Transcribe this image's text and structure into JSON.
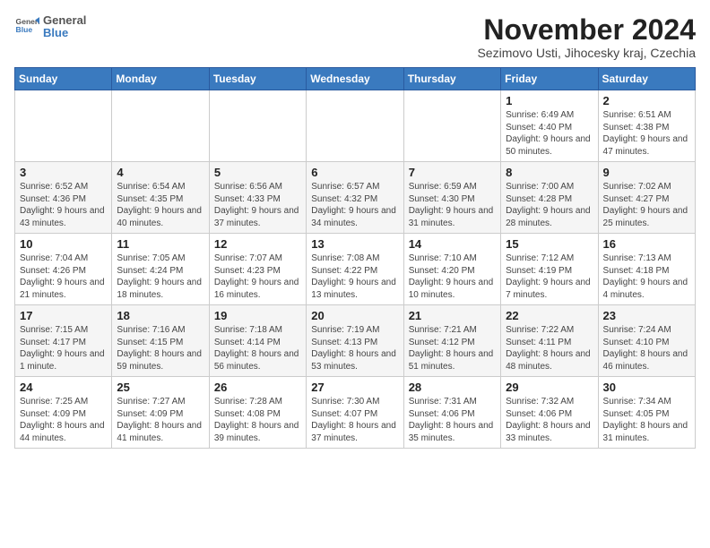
{
  "app": {
    "logo_line1": "General",
    "logo_line2": "Blue"
  },
  "header": {
    "month_title": "November 2024",
    "location": "Sezimovo Usti, Jihocesky kraj, Czechia"
  },
  "weekdays": [
    "Sunday",
    "Monday",
    "Tuesday",
    "Wednesday",
    "Thursday",
    "Friday",
    "Saturday"
  ],
  "weeks": [
    [
      {
        "day": "",
        "info": ""
      },
      {
        "day": "",
        "info": ""
      },
      {
        "day": "",
        "info": ""
      },
      {
        "day": "",
        "info": ""
      },
      {
        "day": "",
        "info": ""
      },
      {
        "day": "1",
        "info": "Sunrise: 6:49 AM\nSunset: 4:40 PM\nDaylight: 9 hours and 50 minutes."
      },
      {
        "day": "2",
        "info": "Sunrise: 6:51 AM\nSunset: 4:38 PM\nDaylight: 9 hours and 47 minutes."
      }
    ],
    [
      {
        "day": "3",
        "info": "Sunrise: 6:52 AM\nSunset: 4:36 PM\nDaylight: 9 hours and 43 minutes."
      },
      {
        "day": "4",
        "info": "Sunrise: 6:54 AM\nSunset: 4:35 PM\nDaylight: 9 hours and 40 minutes."
      },
      {
        "day": "5",
        "info": "Sunrise: 6:56 AM\nSunset: 4:33 PM\nDaylight: 9 hours and 37 minutes."
      },
      {
        "day": "6",
        "info": "Sunrise: 6:57 AM\nSunset: 4:32 PM\nDaylight: 9 hours and 34 minutes."
      },
      {
        "day": "7",
        "info": "Sunrise: 6:59 AM\nSunset: 4:30 PM\nDaylight: 9 hours and 31 minutes."
      },
      {
        "day": "8",
        "info": "Sunrise: 7:00 AM\nSunset: 4:28 PM\nDaylight: 9 hours and 28 minutes."
      },
      {
        "day": "9",
        "info": "Sunrise: 7:02 AM\nSunset: 4:27 PM\nDaylight: 9 hours and 25 minutes."
      }
    ],
    [
      {
        "day": "10",
        "info": "Sunrise: 7:04 AM\nSunset: 4:26 PM\nDaylight: 9 hours and 21 minutes."
      },
      {
        "day": "11",
        "info": "Sunrise: 7:05 AM\nSunset: 4:24 PM\nDaylight: 9 hours and 18 minutes."
      },
      {
        "day": "12",
        "info": "Sunrise: 7:07 AM\nSunset: 4:23 PM\nDaylight: 9 hours and 16 minutes."
      },
      {
        "day": "13",
        "info": "Sunrise: 7:08 AM\nSunset: 4:22 PM\nDaylight: 9 hours and 13 minutes."
      },
      {
        "day": "14",
        "info": "Sunrise: 7:10 AM\nSunset: 4:20 PM\nDaylight: 9 hours and 10 minutes."
      },
      {
        "day": "15",
        "info": "Sunrise: 7:12 AM\nSunset: 4:19 PM\nDaylight: 9 hours and 7 minutes."
      },
      {
        "day": "16",
        "info": "Sunrise: 7:13 AM\nSunset: 4:18 PM\nDaylight: 9 hours and 4 minutes."
      }
    ],
    [
      {
        "day": "17",
        "info": "Sunrise: 7:15 AM\nSunset: 4:17 PM\nDaylight: 9 hours and 1 minute."
      },
      {
        "day": "18",
        "info": "Sunrise: 7:16 AM\nSunset: 4:15 PM\nDaylight: 8 hours and 59 minutes."
      },
      {
        "day": "19",
        "info": "Sunrise: 7:18 AM\nSunset: 4:14 PM\nDaylight: 8 hours and 56 minutes."
      },
      {
        "day": "20",
        "info": "Sunrise: 7:19 AM\nSunset: 4:13 PM\nDaylight: 8 hours and 53 minutes."
      },
      {
        "day": "21",
        "info": "Sunrise: 7:21 AM\nSunset: 4:12 PM\nDaylight: 8 hours and 51 minutes."
      },
      {
        "day": "22",
        "info": "Sunrise: 7:22 AM\nSunset: 4:11 PM\nDaylight: 8 hours and 48 minutes."
      },
      {
        "day": "23",
        "info": "Sunrise: 7:24 AM\nSunset: 4:10 PM\nDaylight: 8 hours and 46 minutes."
      }
    ],
    [
      {
        "day": "24",
        "info": "Sunrise: 7:25 AM\nSunset: 4:09 PM\nDaylight: 8 hours and 44 minutes."
      },
      {
        "day": "25",
        "info": "Sunrise: 7:27 AM\nSunset: 4:09 PM\nDaylight: 8 hours and 41 minutes."
      },
      {
        "day": "26",
        "info": "Sunrise: 7:28 AM\nSunset: 4:08 PM\nDaylight: 8 hours and 39 minutes."
      },
      {
        "day": "27",
        "info": "Sunrise: 7:30 AM\nSunset: 4:07 PM\nDaylight: 8 hours and 37 minutes."
      },
      {
        "day": "28",
        "info": "Sunrise: 7:31 AM\nSunset: 4:06 PM\nDaylight: 8 hours and 35 minutes."
      },
      {
        "day": "29",
        "info": "Sunrise: 7:32 AM\nSunset: 4:06 PM\nDaylight: 8 hours and 33 minutes."
      },
      {
        "day": "30",
        "info": "Sunrise: 7:34 AM\nSunset: 4:05 PM\nDaylight: 8 hours and 31 minutes."
      }
    ]
  ]
}
